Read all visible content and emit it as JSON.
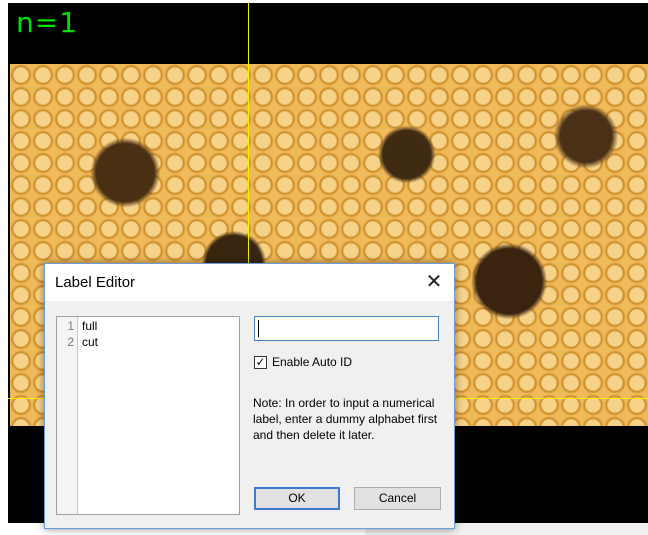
{
  "canvas": {
    "counter_text": "n=1"
  },
  "dialog": {
    "title": "Label Editor",
    "close_glyph": "✕",
    "labels": [
      {
        "num": "1",
        "text": "full"
      },
      {
        "num": "2",
        "text": "cut"
      }
    ],
    "input_value": "",
    "auto_id_label": "Enable Auto ID",
    "auto_id_checked": true,
    "check_glyph": "✓",
    "note": "Note: In order to input a numerical label, enter a dummy alphabet first and then delete it later.",
    "ok_label": "OK",
    "cancel_label": "Cancel"
  },
  "colors": {
    "counter": "#00e000",
    "guide": "#f6f000",
    "dialog_border": "#6b9ed6"
  },
  "icons": [
    "close-icon",
    "checkmark-icon"
  ]
}
